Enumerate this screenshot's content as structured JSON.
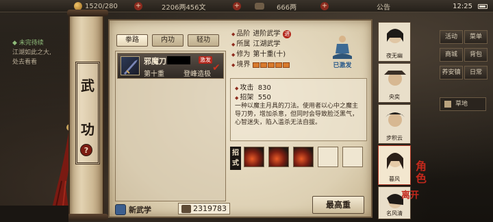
{
  "topbar": {
    "currency1": "1520/280",
    "currency2": "2206两456文",
    "currency3": "666两",
    "announce": "公告",
    "time": "12:25"
  },
  "quest": {
    "title": "未完待续",
    "line1": "江湖如此之大,",
    "line2": "处去看看"
  },
  "scroll_title": [
    "武",
    "功"
  ],
  "help_icon": "?",
  "tabs": [
    "拳路",
    "内功",
    "轻功"
  ],
  "skill": {
    "name": "邪魔刀",
    "badge": "激发",
    "level": "第十重",
    "progress": "登峰造极"
  },
  "info": {
    "grade_label": "品阶",
    "grade_value": "进阶武学",
    "evo_icon": "进",
    "school_label": "所属",
    "school_value": "江湖武学",
    "cult_label": "修为",
    "cult_value": "第十重(十)",
    "realm_label": "境界",
    "realm_pips": 5
  },
  "portrait": {
    "label": "已激发"
  },
  "stats": {
    "atk_label": "攻击",
    "atk_value": "830",
    "def_label": "招架",
    "def_value": "550"
  },
  "description": "一种以魔主月具的刀法。使用者以心中之魔主导刀势，增加杀意，但同时会导致脸泛黑气，心智迷失，陷入滥杀无法自拔。",
  "moves": {
    "tag": "招式",
    "filled": 3,
    "empty": 2
  },
  "bottom": {
    "new_skill": "新武学",
    "points": "2319783",
    "max_button": "最高重"
  },
  "characters": [
    {
      "name": "夜无幽"
    },
    {
      "name": "央奕"
    },
    {
      "name": "步积云"
    },
    {
      "name": "暮风"
    },
    {
      "name": "名风清"
    }
  ],
  "menu": {
    "left": [
      "活动",
      "商城",
      "养安镇"
    ],
    "right": [
      "菜单",
      "背包",
      "日常"
    ],
    "map": "草地"
  },
  "side_mark": [
    "角",
    "色"
  ],
  "side_mark2": "离开",
  "colors": {
    "accent": "#b3261b",
    "paper": "#e6dbc2",
    "ink": "#2b2118"
  }
}
